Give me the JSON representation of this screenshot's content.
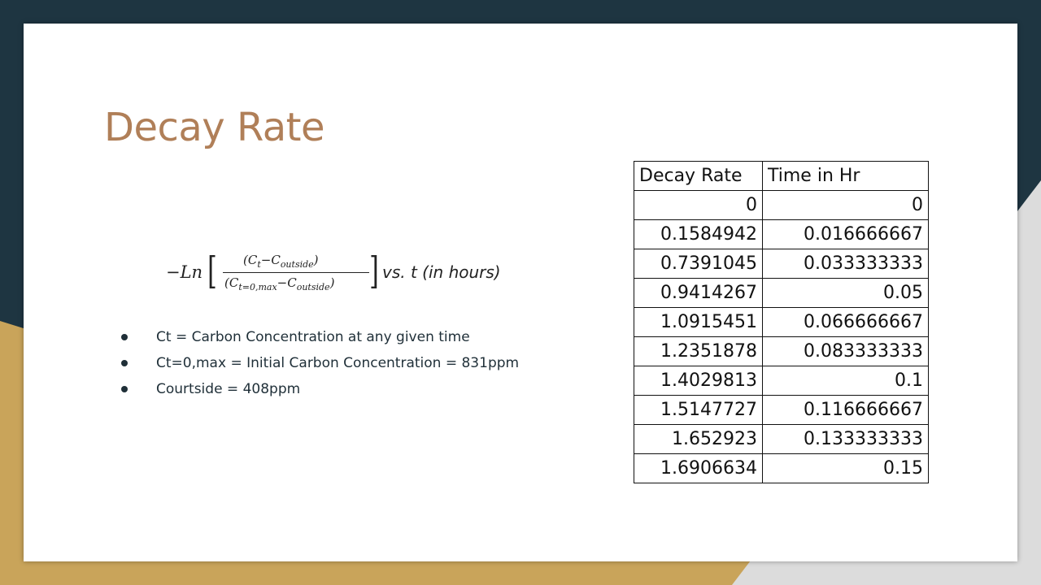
{
  "slide": {
    "title": "Decay Rate",
    "formula": {
      "prefix": "−Ln",
      "numerator": "(Ct−Coutside)",
      "denominator": "(Ct=0,max−Coutside)",
      "suffix": "vs. t (in hours)"
    },
    "bullets": [
      "Ct = Carbon Concentration at any given time",
      "Ct=0,max = Initial Carbon Concentration = 831ppm",
      "Courtside = 408ppm"
    ],
    "table": {
      "headers": [
        "Decay Rate",
        "Time in Hr"
      ],
      "rows": [
        [
          "0",
          "0"
        ],
        [
          "0.1584942",
          "0.016666667"
        ],
        [
          "0.7391045",
          "0.033333333"
        ],
        [
          "0.9414267",
          "0.05"
        ],
        [
          "1.0915451",
          "0.066666667"
        ],
        [
          "1.2351878",
          "0.083333333"
        ],
        [
          "1.4029813",
          "0.1"
        ],
        [
          "1.5147727",
          "0.116666667"
        ],
        [
          "1.652923",
          "0.133333333"
        ],
        [
          "1.6906634",
          "0.15"
        ]
      ]
    }
  },
  "colors": {
    "background_dark": "#1e3541",
    "background_gold": "#c9a45a",
    "background_gray": "#d9d9d9",
    "title": "#b07f58"
  }
}
